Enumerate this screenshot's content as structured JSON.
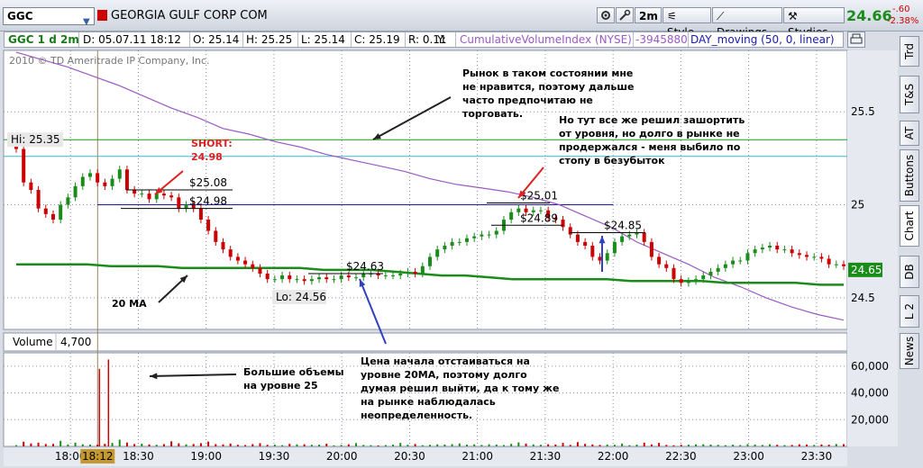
{
  "toolbar": {
    "symbol": "GGC",
    "company": "GEORGIA GULF CORP COM",
    "timeframe_label": "2m",
    "style_label": "Style",
    "drawings_label": "Drawings",
    "studies_label": "Studies",
    "last_price": "24.66",
    "change": "-.60",
    "change_pct": "-2.38%"
  },
  "infobar": {
    "title": "GGC 1 d 2m",
    "date": "D: 05.07.11 18:12",
    "open": "O: 25.14",
    "high": "H: 25.25",
    "low": "L: 25.14",
    "close": "C: 25.19",
    "range": "R: 0.11",
    "y": "Y:",
    "cvi_label": "CumulativeVolumeIndex (NYSE)",
    "cvi_value": "-3945880",
    "ma_label": "DAY_moving (50, 0, linear)"
  },
  "side_tabs": [
    "Trd",
    "T&S",
    "AT",
    "Buttons",
    "Chart",
    "DB",
    "L 2",
    "News"
  ],
  "icons": {
    "symbol_dropdown": "chevron-down-icon",
    "flag": "red-flag-icon",
    "gear": "gear-icon",
    "style": "style-icon",
    "drawings": "drawings-icon",
    "studies": "studies-icon",
    "print": "print-icon"
  },
  "colors": {
    "price_up": "#1a8c1a",
    "price_down": "#cc0000",
    "ma": "#1a8c1a",
    "cvi": "#9b59c4",
    "levels": "#1a1ab0",
    "high_line": "#1a9a1a",
    "cyan_line": "#38b8d8",
    "crosshair": "#a08060"
  },
  "chart_data": {
    "type": "candlestick",
    "copyright": "2010 © TD Ameritrade IP Company, Inc.",
    "price_axis": {
      "ticks": [
        "25.5",
        "25",
        "24.5"
      ],
      "values": [
        25.5,
        25.0,
        24.5
      ],
      "range": [
        24.33,
        25.83
      ]
    },
    "volume_axis": {
      "ticks": [
        "60,000",
        "40,000",
        "20,000"
      ],
      "values": [
        60000,
        40000,
        20000
      ],
      "range": [
        0,
        70000
      ]
    },
    "time_axis": {
      "ticks": [
        "18:00",
        "18:30",
        "19:00",
        "19:30",
        "20:00",
        "20:30",
        "21:00",
        "21:30",
        "22:00",
        "22:30",
        "23:00",
        "23:30"
      ],
      "cursor": "18:12"
    },
    "hi_label": "Hi: 25.35",
    "lo_label": "Lo: 24.56",
    "hi": 25.35,
    "lo": 24.56,
    "current_price": "24.65",
    "current_value": 24.65,
    "volume_label": "Volume",
    "volume_value": "4,700",
    "levels": [
      {
        "label": "$25.08",
        "value": 25.08
      },
      {
        "label": "$24.98",
        "value": 24.98
      },
      {
        "label": "$24.63",
        "value": 24.63
      },
      {
        "label": "$25.01",
        "value": 25.01
      },
      {
        "label": "$24.89",
        "value": 24.89
      },
      {
        "label": "$24.85",
        "value": 24.85
      }
    ],
    "blue_line": 25.0,
    "cyan_line": 25.26,
    "green_hi_line": 25.35,
    "closes": [
      25.3,
      25.12,
      25.08,
      24.98,
      24.95,
      24.92,
      25.0,
      25.04,
      25.1,
      25.15,
      25.17,
      25.12,
      25.1,
      25.14,
      25.19,
      25.08,
      25.06,
      25.06,
      25.03,
      25.06,
      25.05,
      25.04,
      24.98,
      25.0,
      24.98,
      24.92,
      24.86,
      24.8,
      24.76,
      24.72,
      24.7,
      24.68,
      24.66,
      24.63,
      24.6,
      24.6,
      24.62,
      24.6,
      24.6,
      24.59,
      24.6,
      24.61,
      24.6,
      24.6,
      24.62,
      24.61,
      24.61,
      24.63,
      24.63,
      24.62,
      24.62,
      24.62,
      24.63,
      24.64,
      24.63,
      24.67,
      24.72,
      24.76,
      24.78,
      24.8,
      24.8,
      24.82,
      24.83,
      24.84,
      24.84,
      24.86,
      24.92,
      24.96,
      24.98,
      24.96,
      24.97,
      24.97,
      24.93,
      24.92,
      24.88,
      24.84,
      24.8,
      24.78,
      24.72,
      24.7,
      24.74,
      24.8,
      24.83,
      24.84,
      24.85,
      24.8,
      24.72,
      24.68,
      24.66,
      24.6,
      24.58,
      24.59,
      24.6,
      24.62,
      24.64,
      24.66,
      24.68,
      24.7,
      24.7,
      24.74,
      24.76,
      24.77,
      24.78,
      24.76,
      24.76,
      24.74,
      24.73,
      24.72,
      24.72,
      24.71,
      24.68,
      24.68,
      24.67
    ],
    "volumes": [
      900,
      3500,
      2200,
      2800,
      1800,
      1900,
      4200,
      1500,
      2800,
      1600,
      1400,
      1300,
      1900,
      2600,
      5000,
      2900,
      1800,
      2100,
      1500,
      1200,
      1700,
      3800,
      2300,
      1500,
      1800,
      2400,
      3600,
      1700,
      1500,
      2100,
      1200,
      1000,
      1700,
      2400,
      1200,
      1300,
      900,
      1900,
      1500,
      1600,
      1200,
      1300,
      2000,
      800,
      1100,
      1600,
      2500,
      1100,
      900,
      700,
      1000,
      1300,
      2600,
      1200,
      1800,
      900,
      1200,
      1600,
      1400,
      1700,
      2200,
      1300,
      1500,
      1100,
      1600,
      1400,
      1000,
      1900,
      3000,
      2100,
      1500,
      1200,
      1600,
      1400,
      2600,
      1100,
      3200,
      1900,
      1500,
      1100,
      1400,
      1200,
      2100,
      900,
      1300,
      2800,
      1500,
      2600,
      1100,
      800,
      1200,
      1300,
      1500,
      1600,
      1400,
      1200,
      900,
      1300,
      1000,
      1700,
      1400,
      1100,
      1600,
      1200,
      1000,
      1100,
      1600,
      1400,
      1100,
      1500,
      1300,
      1800,
      1700
    ],
    "spikes": [
      {
        "time": "18:12",
        "volume": 58000
      },
      {
        "time": "18:16",
        "volume": 65000
      }
    ],
    "ma20": [
      24.68,
      24.68,
      24.68,
      24.68,
      24.67,
      24.67,
      24.67,
      24.66,
      24.66,
      24.66,
      24.66,
      24.66,
      24.66,
      24.65,
      24.65,
      24.65,
      24.64,
      24.63,
      24.62,
      24.62,
      24.61,
      24.6,
      24.6,
      24.6,
      24.6,
      24.6,
      24.59,
      24.59,
      24.59,
      24.59,
      24.58,
      24.58,
      24.58,
      24.58,
      24.57,
      24.57
    ],
    "cvi_values": [
      25.82,
      25.78,
      25.74,
      25.69,
      25.64,
      25.58,
      25.52,
      25.47,
      25.41,
      25.38,
      25.34,
      25.31,
      25.27,
      25.24,
      25.21,
      25.18,
      25.14,
      25.11,
      25.09,
      25.07,
      25.04,
      25.0,
      24.94,
      24.88,
      24.8,
      24.74,
      24.68,
      24.61,
      24.56,
      24.5,
      24.45,
      24.41,
      24.38
    ],
    "annotations": [
      {
        "lines": [
          "Рынок в таком состоянии мне",
          "не нравится, поэтому дальше",
          "часто предпочитаю не",
          "торговать."
        ]
      },
      {
        "lines": [
          "Но тут все же решил зашортить",
          "от уровня, но долго в рынке не",
          "продержался - меня выбило по",
          "стопу в безубыток"
        ]
      },
      {
        "lines": [
          "SHORT:",
          "24.98"
        ]
      },
      {
        "lines": [
          "20 MA"
        ]
      },
      {
        "lines": [
          "Большие объемы",
          "на уровне 25"
        ]
      },
      {
        "lines": [
          "Цена начала отстаиваться на",
          "уровне 20МА, поэтому долго",
          "думая решил выйти, да к тому же",
          "на рынке наблюдалась",
          "неопределенность."
        ]
      }
    ]
  }
}
